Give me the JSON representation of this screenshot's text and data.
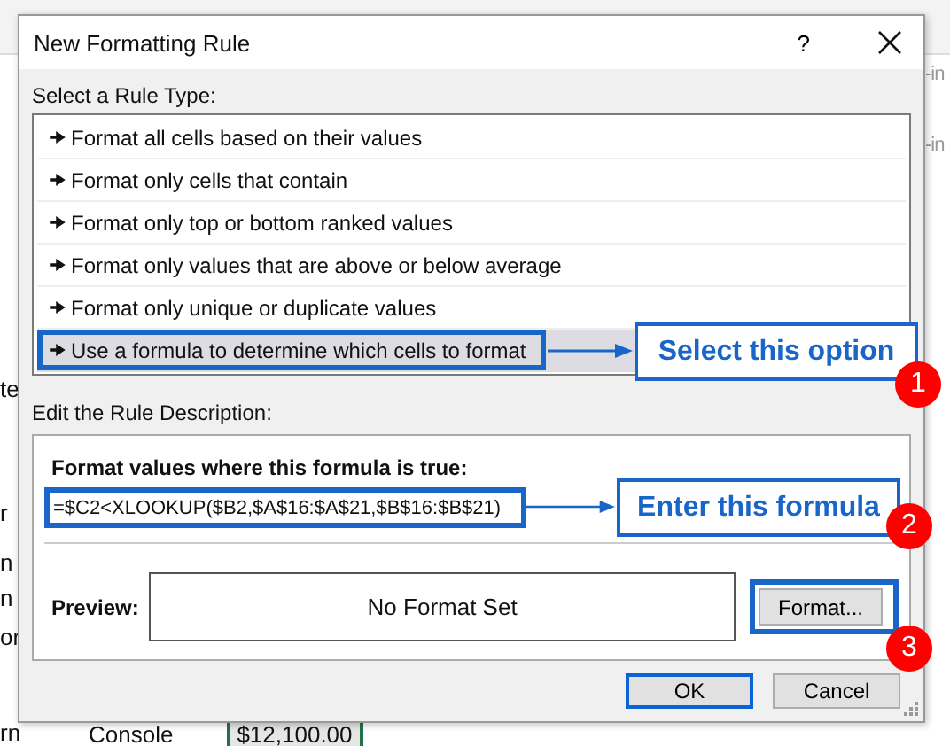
{
  "background": {
    "right_fragments": [
      "-in",
      "-in"
    ],
    "left_fragments": [
      "te",
      "r",
      "n",
      "n",
      "or",
      "rn"
    ],
    "cells": [
      {
        "text": "Console",
        "selected": false
      },
      {
        "text": "$12,100.00",
        "selected": true
      }
    ]
  },
  "dialog": {
    "title": "New Formatting Rule",
    "help": "?",
    "rule_type_label": "Select a Rule Type:",
    "rule_types": [
      {
        "label": "Format all cells based on their values",
        "selected": false
      },
      {
        "label": "Format only cells that contain",
        "selected": false
      },
      {
        "label": "Format only top or bottom ranked values",
        "selected": false
      },
      {
        "label": "Format only values that are above or below average",
        "selected": false
      },
      {
        "label": "Format only unique or duplicate values",
        "selected": false
      },
      {
        "label": "Use a formula to determine which cells to format",
        "selected": true
      }
    ],
    "description_label": "Edit the Rule Description:",
    "formula_label": "Format values where this formula is true:",
    "formula": "=$C2<XLOOKUP($B2,$A$16:$A$21,$B$16:$B$21)",
    "preview_label": "Preview:",
    "preview_text": "No Format Set",
    "format_button": "Format...",
    "buttons": [
      {
        "label": "OK",
        "default": true
      },
      {
        "label": "Cancel",
        "default": false
      }
    ]
  },
  "callouts": [
    {
      "text": "Select this option",
      "number": "1"
    },
    {
      "text": "Enter this formula",
      "number": "2"
    },
    {
      "number": "3"
    }
  ]
}
